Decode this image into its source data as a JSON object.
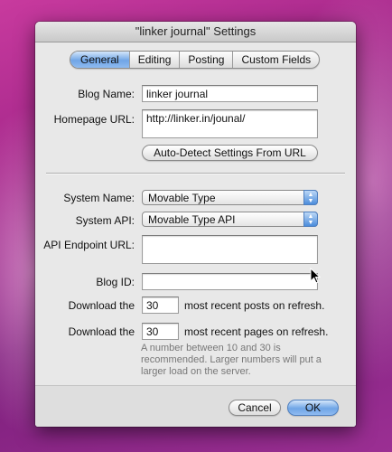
{
  "window": {
    "title": "\"linker journal\" Settings"
  },
  "tabs": [
    "General",
    "Editing",
    "Posting",
    "Custom Fields"
  ],
  "form": {
    "blog_name_label": "Blog Name:",
    "blog_name_value": "linker journal",
    "homepage_url_label": "Homepage URL:",
    "homepage_url_value": "http://linker.in/jounal/",
    "auto_detect_label": "Auto-Detect Settings From URL",
    "system_name_label": "System Name:",
    "system_name_value": "Movable Type",
    "system_api_label": "System API:",
    "system_api_value": "Movable Type API",
    "api_endpoint_label": "API Endpoint URL:",
    "api_endpoint_value": "",
    "blog_id_label": "Blog ID:",
    "blog_id_value": "",
    "download_label": "Download the",
    "posts_count": "30",
    "posts_suffix": "most recent posts on refresh.",
    "pages_count": "30",
    "pages_suffix": "most recent pages on refresh.",
    "note": "A number between 10 and 30 is recommended. Larger numbers will put a larger load on the server."
  },
  "buttons": {
    "cancel": "Cancel",
    "ok": "OK"
  },
  "icons": {
    "stepper": "up-down-arrows-icon",
    "cursor": "mouse-pointer-icon"
  }
}
